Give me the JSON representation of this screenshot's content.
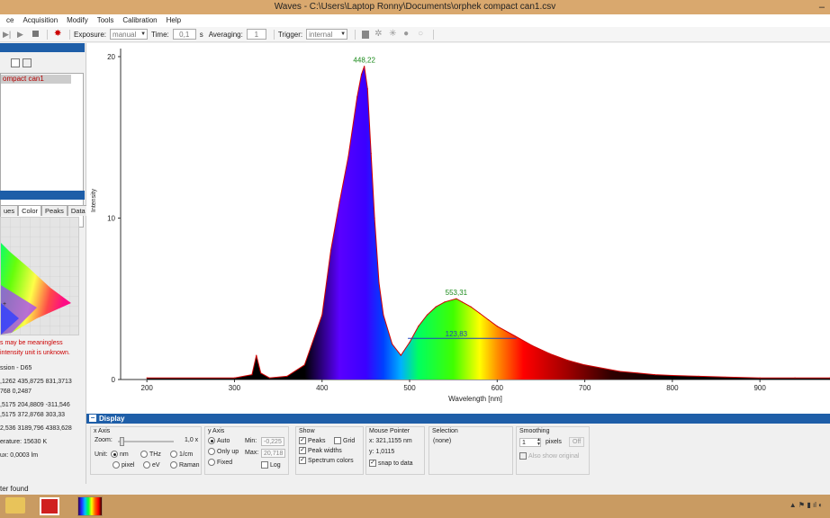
{
  "window": {
    "title": "Waves  -  C:\\Users\\Laptop Ronny\\Documents\\orphek compact can1.csv",
    "minimize": "–"
  },
  "menu": [
    "ce",
    "Acquisition",
    "Modify",
    "Tools",
    "Calibration",
    "Help"
  ],
  "toolbar": {
    "exposure_label": "Exposure:",
    "exposure_value": "manual",
    "time_label": "Time:",
    "time_value": "0,1",
    "time_unit": "s",
    "averaging_label": "Averaging:",
    "averaging_value": "1",
    "trigger_label": "Trigger:",
    "trigger_value": "internal"
  },
  "left": {
    "file_item": "ompact can1",
    "tabs": [
      "ues",
      "Color",
      "Peaks",
      "Data"
    ],
    "warning_1": "s may be meaningless",
    "warning_2": "intensity unit is unknown.",
    "rows": [
      "ssion - D65",
      ",1262  435,8725  831,3713",
      "768    0,2487",
      ",5175  204,8809  -311,546",
      ",5175  372,8768  303,33",
      "2,536  3189,796  4383,628",
      "erature:  15630 K",
      "ux:       0,0003 lm"
    ]
  },
  "plot": {
    "ylabel": "Intensity",
    "xlabel": "Wavelength [nm]"
  },
  "chart_data": {
    "type": "line",
    "xlabel": "Wavelength [nm]",
    "ylabel": "Intensity",
    "xlim": [
      170,
      980
    ],
    "ylim": [
      0,
      20.5
    ],
    "xticks": [
      200,
      300,
      400,
      500,
      600,
      700,
      800,
      900
    ],
    "yticks": [
      0,
      10,
      20
    ],
    "series": [
      {
        "x": [
          200,
          300,
          320,
          325,
          330,
          340,
          360,
          380,
          400,
          410,
          420,
          430,
          440,
          445,
          448.22,
          452,
          456,
          460,
          465,
          470,
          480,
          490,
          500,
          510,
          520,
          530,
          540,
          553.31,
          560,
          570,
          580,
          590,
          600,
          620,
          640,
          660,
          680,
          700,
          720,
          740,
          760,
          780,
          800,
          830,
          860,
          900,
          940,
          980
        ],
        "values": [
          0.1,
          0.1,
          0.3,
          1.5,
          0.4,
          0.1,
          0.2,
          0.9,
          4.0,
          8.0,
          11.0,
          13.8,
          17.5,
          18.9,
          19.4,
          18.0,
          14.0,
          10.0,
          6.0,
          4.0,
          2.2,
          1.5,
          2.3,
          3.3,
          4.0,
          4.5,
          4.8,
          5.0,
          4.8,
          4.5,
          4.1,
          3.7,
          3.3,
          2.7,
          2.1,
          1.6,
          1.2,
          0.9,
          0.7,
          0.5,
          0.4,
          0.3,
          0.25,
          0.2,
          0.15,
          0.1,
          0.1,
          0.1
        ]
      }
    ],
    "peaks": [
      {
        "x": 448.22,
        "y": 19.4,
        "label": "448,22"
      },
      {
        "x": 553.31,
        "y": 5.0,
        "label": "553,31"
      }
    ],
    "width_label": {
      "x": 553.31,
      "y": 2.55,
      "label": "123,83"
    }
  },
  "display": {
    "title": "Display",
    "xaxis": {
      "title": "x Axis",
      "zoom_label": "Zoom:",
      "zoom_value": "1,0 x",
      "unit_label": "Unit:",
      "units": [
        "nm",
        "THz",
        "1/cm",
        "pixel",
        "eV",
        "Raman"
      ]
    },
    "yaxis": {
      "title": "y Axis",
      "modes": [
        "Auto",
        "Only up",
        "Fixed"
      ],
      "min_label": "Min:",
      "min_value": "-0,225",
      "max_label": "Max:",
      "max_value": "20,718",
      "log_label": "Log"
    },
    "show": {
      "title": "Show",
      "peaks": "Peaks",
      "grid": "Grid",
      "peak_widths": "Peak widths",
      "spectrum_colors": "Spectrum colors"
    },
    "mouse": {
      "title": "Mouse Pointer",
      "x": "x: 321,1155 nm",
      "y": "y: 1,0115",
      "snap": "snap to data"
    },
    "selection": {
      "title": "Selection",
      "value": "(none)"
    },
    "smoothing": {
      "title": "Smoothing",
      "value": "1",
      "unit": "pixels",
      "off": "Off",
      "also": "Also show original"
    }
  },
  "status": "ter found"
}
